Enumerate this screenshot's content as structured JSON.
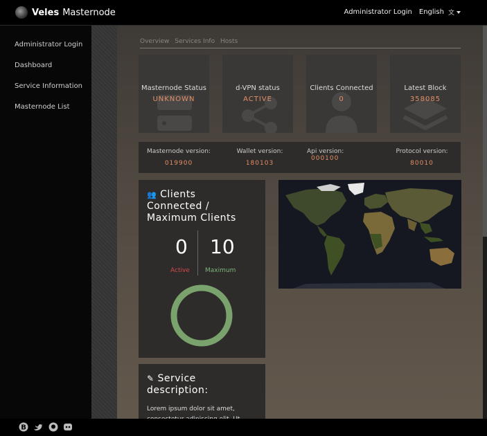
{
  "brand": {
    "bold": "Veles",
    "rest": "Masternode"
  },
  "header": {
    "login": "Administrator Login",
    "language": "English",
    "lang_icon": "文"
  },
  "sidebar": {
    "items": [
      "Administrator Login",
      "Dashboard",
      "Service Information",
      "Masternode List"
    ]
  },
  "tabs": [
    "Overview",
    "Services Info",
    "Hosts"
  ],
  "stats": [
    {
      "label": "Masternode Status",
      "value": "UNKNOWN",
      "icon": "server-icon"
    },
    {
      "label": "d-VPN status",
      "value": "ACTIVE",
      "icon": "share-icon"
    },
    {
      "label": "Clients Connected",
      "value": "0",
      "icon": "user-icon"
    },
    {
      "label": "Latest Block",
      "value": "358085",
      "icon": "layers-icon"
    }
  ],
  "versions": [
    {
      "label": "Masternode version:",
      "value": "019900"
    },
    {
      "label": "Wallet version:",
      "value": "180103"
    },
    {
      "label": "Api version:",
      "value": "000100"
    },
    {
      "label": "Protocol version:",
      "value": "80010"
    }
  ],
  "clients": {
    "title_line1": "Clients",
    "title_line2": "Connected /",
    "title_line3": "Maximum Clients",
    "active": "0",
    "maximum": "10",
    "active_label": "Active",
    "maximum_label": "Maximum",
    "ring_fill_fraction": 1.0,
    "ring_color": "#7aa26d"
  },
  "description": {
    "title_line1": "Service",
    "title_line2": "description:",
    "text": "Lorem ipsum dolor sit amet, consectetur adipiscing elit. Ut"
  },
  "colors": {
    "accent": "#e48e66",
    "active": "#d24a4a",
    "ok": "#7ab57a"
  }
}
